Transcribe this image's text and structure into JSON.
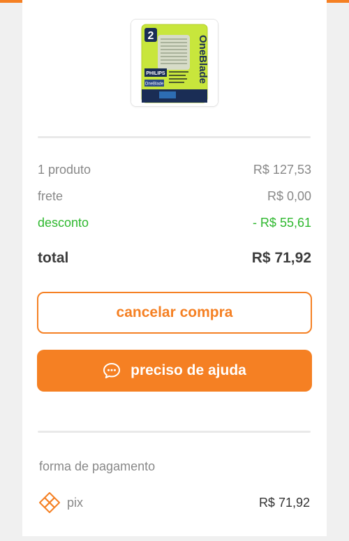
{
  "product": {
    "image_alt": "Philips OneBlade 2 lâminas",
    "pack_count": "2",
    "brand": "PHILIPS",
    "line": "OneBlade",
    "accent_color": "#c8e63c"
  },
  "summary": {
    "products_label": "1 produto",
    "products_value": "R$ 127,53",
    "shipping_label": "frete",
    "shipping_value": "R$ 0,00",
    "discount_label": "desconto",
    "discount_value": "- R$ 55,61",
    "total_label": "total",
    "total_value": "R$ 71,92"
  },
  "actions": {
    "cancel_label": "cancelar compra",
    "help_label": "preciso de ajuda",
    "help_icon": "chat-bubble-icon"
  },
  "payment": {
    "section_label": "forma de pagamento",
    "method_name": "pix",
    "method_icon": "pix-icon",
    "amount": "R$ 71,92"
  },
  "colors": {
    "accent": "#f58023",
    "discount": "#2fb82f"
  }
}
